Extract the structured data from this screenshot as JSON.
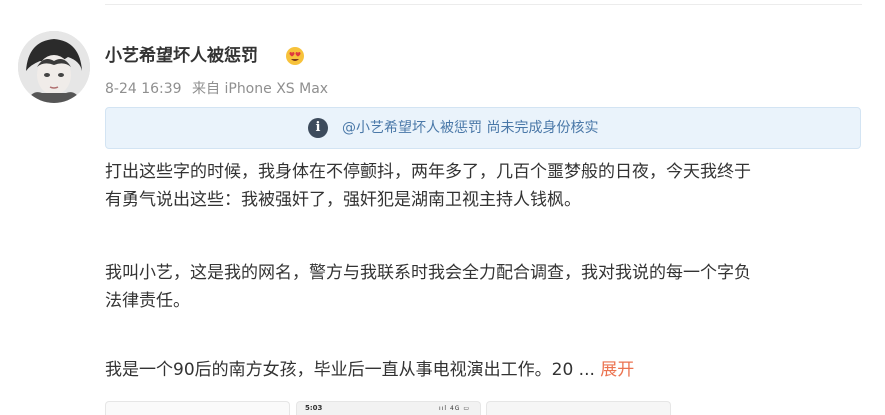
{
  "post": {
    "username": "小艺希望坏人被惩罚",
    "timestamp": "8-24 16:39",
    "source": "来自 iPhone XS Max",
    "notice": {
      "icon": "info-icon",
      "text": "@小艺希望坏人被惩罚 尚未完成身份核实"
    },
    "paragraphs": [
      "打出这些字的时候，我身体在不停颤抖，两年多了，几百个噩梦般的日夜，今天我终于",
      "有勇气说出这些：我被强奸了，强奸犯是湖南卫视主持人钱枫。",
      "我叫小艺，这是我的网名，警方与我联系时我会全力配合调查，我对我说的每一个字负",
      "法律责任。",
      "我是一个90后的南方女孩，毕业后一直从事电视演出工作。20"
    ],
    "ellipsis": "...",
    "expand_label": "展开",
    "thumbnails": [
      {
        "status_time": "",
        "status_icons": ""
      },
      {
        "status_time": "5:03",
        "status_icons": "ııl 4G ▭"
      },
      {
        "status_time": "",
        "status_icons": ""
      }
    ]
  },
  "colors": {
    "link": "#eb7350",
    "notice_bg": "#eaf3fb",
    "notice_text": "#4a78a8",
    "meta_text": "#8f8f8f"
  }
}
